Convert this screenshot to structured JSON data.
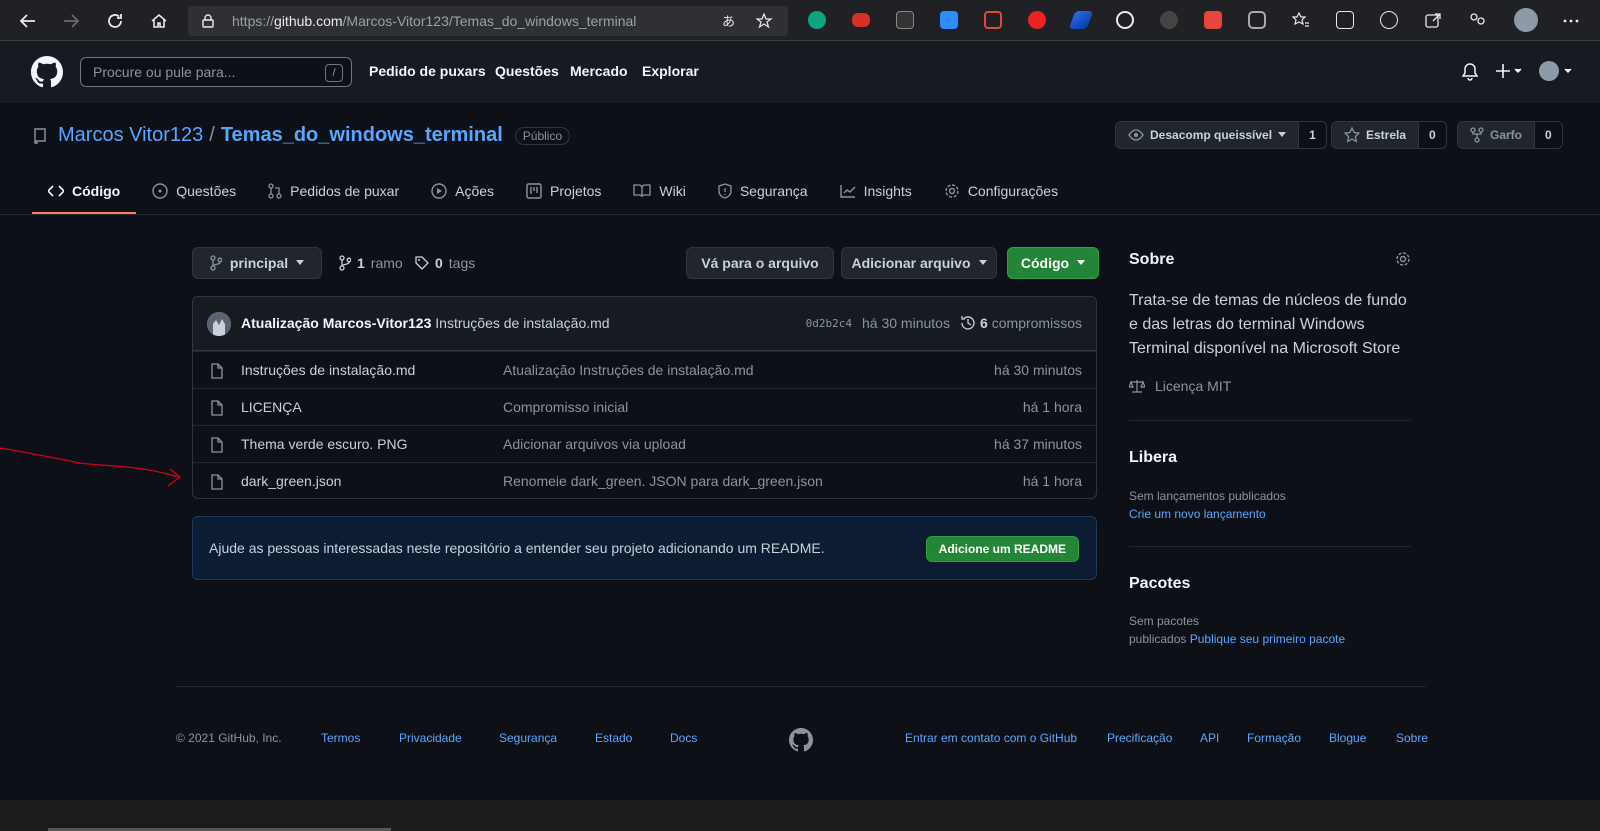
{
  "browser": {
    "url_prefix": "https://",
    "url_domain": "github.com",
    "url_path": "/Marcos-Vitor123/Temas_do_windows_terminal"
  },
  "header": {
    "search_placeholder": "Procure ou pule para...",
    "search_key": "/",
    "nav": [
      "Pedido de puxars",
      "Questões",
      "Mercado",
      "Explorar"
    ]
  },
  "repo": {
    "owner": "Marcos Vitor123",
    "separator": "/",
    "name": "Temas_do_windows_terminal",
    "visibility": "Público",
    "watch_label": "Desacomp queissível",
    "watch_count": "1",
    "star_label": "Estrela",
    "star_count": "0",
    "fork_label": "Garfo",
    "fork_count": "0"
  },
  "tabs": [
    "Código",
    "Questões",
    "Pedidos de puxar",
    "Ações",
    "Projetos",
    "Wiki",
    "Segurança",
    "Insights",
    "Configurações"
  ],
  "filenav": {
    "branch": "principal",
    "branches_count": "1",
    "branches_label": "ramo",
    "tags_count": "0",
    "tags_label": "tags",
    "goto_file": "Vá para o arquivo",
    "add_file": "Adicionar arquivo",
    "code": "Código"
  },
  "commit": {
    "title": "Atualização Marcos-Vitor123",
    "message": "Instruções de instalação.md",
    "sha": "0d2b2c4",
    "age": "há 30 minutos",
    "commits_count": "6",
    "commits_label": "compromissos"
  },
  "files": [
    {
      "name": "Instruções de instalação.md",
      "message": "Atualização Instruções de instalação.md",
      "age": "há 30 minutos"
    },
    {
      "name": "LICENÇA",
      "message": "Compromisso inicial",
      "age": "há 1 hora"
    },
    {
      "name": "Thema verde escuro. PNG",
      "message": "Adicionar arquivos via upload",
      "age": "há 37 minutos"
    },
    {
      "name": "dark_green.json",
      "message": "Renomeie dark_green. JSON para dark_green.json",
      "age": "há 1 hora"
    }
  ],
  "readme": {
    "text": "Ajude as pessoas interessadas neste repositório a entender seu projeto adicionando um README.",
    "button": "Adicione um README"
  },
  "sidebar": {
    "about_title": "Sobre",
    "description": "Trata-se de temas de núcleos de fundo e das letras do terminal Windows Terminal disponível na Microsoft Store",
    "license": "Licença MIT",
    "releases_title": "Libera",
    "releases_none": "Sem lançamentos publicados",
    "releases_link": "Crie um novo lançamento",
    "packages_title": "Pacotes",
    "packages_none_1": "Sem pacotes",
    "packages_none_2": "publicados",
    "packages_link": "Publique seu primeiro pacote"
  },
  "footer": {
    "copyright": "© 2021 GitHub, Inc.",
    "left_links": [
      "Termos",
      "Privacidade",
      "Segurança",
      "Estado",
      "Docs"
    ],
    "right_links": [
      "Entrar em contato com o GitHub",
      "Precificação",
      "API",
      "Formação",
      "Blogue",
      "Sobre"
    ]
  },
  "colors": {
    "accent_link": "#58a6ff",
    "primary_button": "#238636",
    "annotation_arrow": "#d0021b"
  }
}
